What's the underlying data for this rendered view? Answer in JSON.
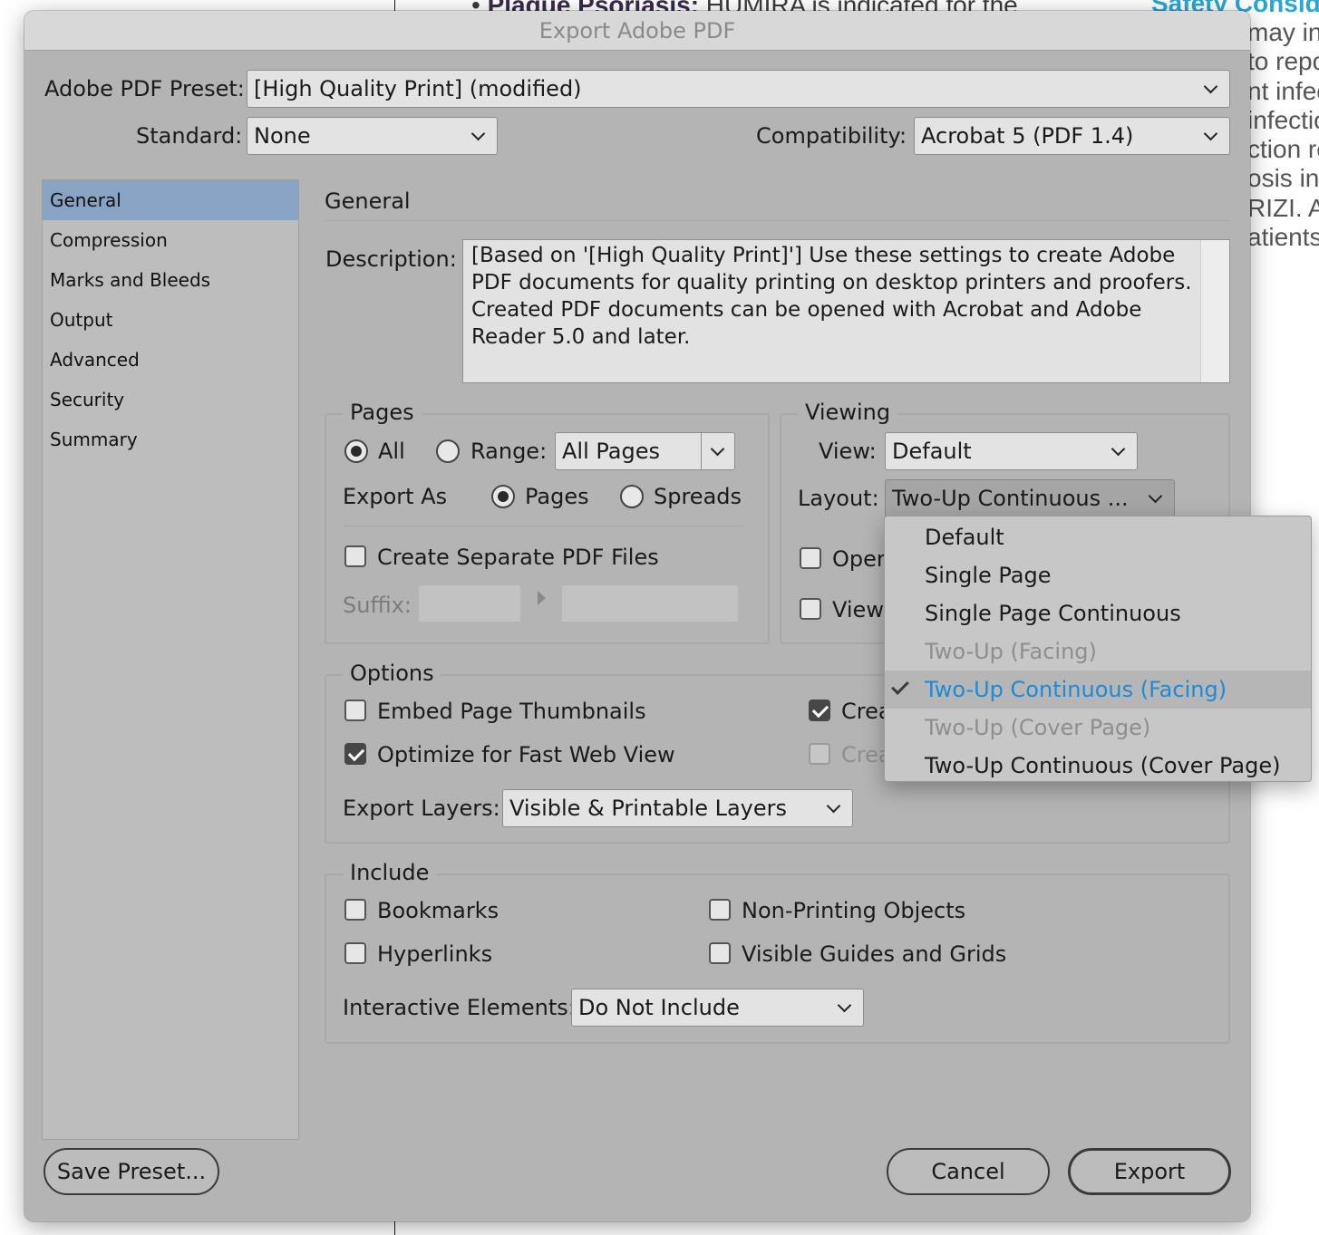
{
  "background": {
    "top_line_bold": "Plaque Psoriasis:",
    "top_line_rest": " HUMIRA is indicated for the",
    "top_right_heading": "Safety Consid",
    "right_lines": [
      "may inc",
      "to repo",
      "nt infec",
      "infectio",
      "ction re",
      "osis info",
      "RIZI. Av",
      "atients"
    ]
  },
  "dialog": {
    "title": "Export Adobe PDF",
    "preset_label": "Adobe PDF Preset:",
    "preset_value": "[High Quality Print] (modified)",
    "standard_label": "Standard:",
    "standard_value": "None",
    "compatibility_label": "Compatibility:",
    "compatibility_value": "Acrobat 5 (PDF 1.4)"
  },
  "nav": {
    "items": [
      "General",
      "Compression",
      "Marks and Bleeds",
      "Output",
      "Advanced",
      "Security",
      "Summary"
    ],
    "active": "General"
  },
  "general": {
    "heading": "General",
    "description_label": "Description:",
    "description_text": "[Based on '[High Quality Print]'] Use these settings to create Adobe PDF documents for quality printing on desktop printers and proofers.  Created PDF documents can be opened with Acrobat and Adobe Reader 5.0 and later."
  },
  "pages": {
    "title": "Pages",
    "all_label": "All",
    "all_checked": true,
    "range_label": "Range:",
    "range_value": "All Pages",
    "export_as_label": "Export As",
    "pages_label": "Pages",
    "pages_checked": true,
    "spreads_label": "Spreads",
    "spreads_checked": false,
    "separate_label": "Create Separate PDF Files",
    "separate_checked": false,
    "suffix_label": "Suffix:"
  },
  "viewing": {
    "title": "Viewing",
    "view_label": "View:",
    "view_value": "Default",
    "layout_label": "Layout:",
    "layout_value": "Two-Up Continuous ...",
    "open_label": "Open",
    "view_after_label": "View"
  },
  "options": {
    "title": "Options",
    "embed_label": "Embed Page Thumbnails",
    "embed_checked": false,
    "optimize_label": "Optimize for Fast Web View",
    "optimize_checked": true,
    "create1_label": "Crea",
    "create1_checked": true,
    "create2_label": "Crea",
    "create2_checked": false,
    "export_layers_label": "Export Layers:",
    "export_layers_value": "Visible & Printable Layers"
  },
  "include": {
    "title": "Include",
    "bookmarks_label": "Bookmarks",
    "hyperlinks_label": "Hyperlinks",
    "nonprinting_label": "Non-Printing Objects",
    "guides_label": "Visible Guides and Grids",
    "interactive_label": "Interactive Elements:",
    "interactive_value": "Do Not Include"
  },
  "buttons": {
    "save_preset": "Save Preset...",
    "cancel": "Cancel",
    "export": "Export"
  },
  "layout_menu": {
    "items": [
      {
        "label": "Default",
        "state": "normal"
      },
      {
        "label": "Single Page",
        "state": "normal"
      },
      {
        "label": "Single Page Continuous",
        "state": "normal"
      },
      {
        "label": "Two-Up (Facing)",
        "state": "disabled"
      },
      {
        "label": "Two-Up Continuous (Facing)",
        "state": "selected"
      },
      {
        "label": "Two-Up (Cover Page)",
        "state": "disabled"
      },
      {
        "label": "Two-Up Continuous (Cover Page)",
        "state": "normal"
      }
    ]
  },
  "colors": {
    "dialog_bg": "#b4b4b4",
    "nav_active": "#88a3c4",
    "menu_selected_text": "#1d8ad8"
  }
}
